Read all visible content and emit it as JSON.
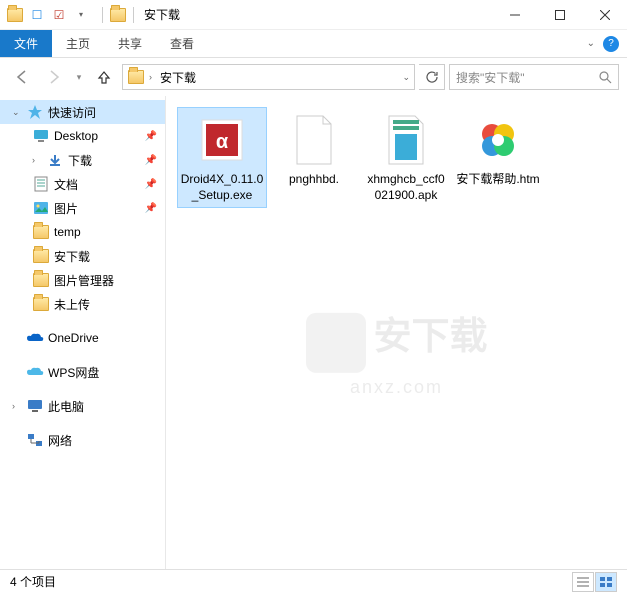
{
  "window": {
    "title": "安下载",
    "minimize": "—",
    "maximize": "☐",
    "close": "✕"
  },
  "ribbon": {
    "file": "文件",
    "tabs": [
      "主页",
      "共享",
      "查看"
    ]
  },
  "address": {
    "segments": [
      "安下载"
    ],
    "search_placeholder": "搜索\"安下载\""
  },
  "nav": {
    "quick_access": "快速访问",
    "items": [
      {
        "label": "Desktop",
        "pinned": true,
        "icon": "desktop"
      },
      {
        "label": "下载",
        "pinned": true,
        "icon": "downloads"
      },
      {
        "label": "文档",
        "pinned": true,
        "icon": "documents"
      },
      {
        "label": "图片",
        "pinned": true,
        "icon": "pictures"
      },
      {
        "label": "temp",
        "pinned": false,
        "icon": "folder"
      },
      {
        "label": "安下载",
        "pinned": false,
        "icon": "folder"
      },
      {
        "label": "图片管理器",
        "pinned": false,
        "icon": "folder"
      },
      {
        "label": "未上传",
        "pinned": false,
        "icon": "folder"
      }
    ],
    "onedrive": "OneDrive",
    "wps": "WPS网盘",
    "this_pc": "此电脑",
    "network": "网络"
  },
  "files": [
    {
      "name": "Droid4X_0.11.0_Setup.exe",
      "type": "exe",
      "selected": true
    },
    {
      "name": "pnghhbd.",
      "type": "blank",
      "selected": false
    },
    {
      "name": "xhmghcb_ccf0021900.apk",
      "type": "apk",
      "selected": false
    },
    {
      "name": "安下载帮助.htm",
      "type": "htm",
      "selected": false
    }
  ],
  "watermark": {
    "text": "安下载",
    "url": "anxz.com"
  },
  "status": {
    "count": "4 个项目"
  }
}
